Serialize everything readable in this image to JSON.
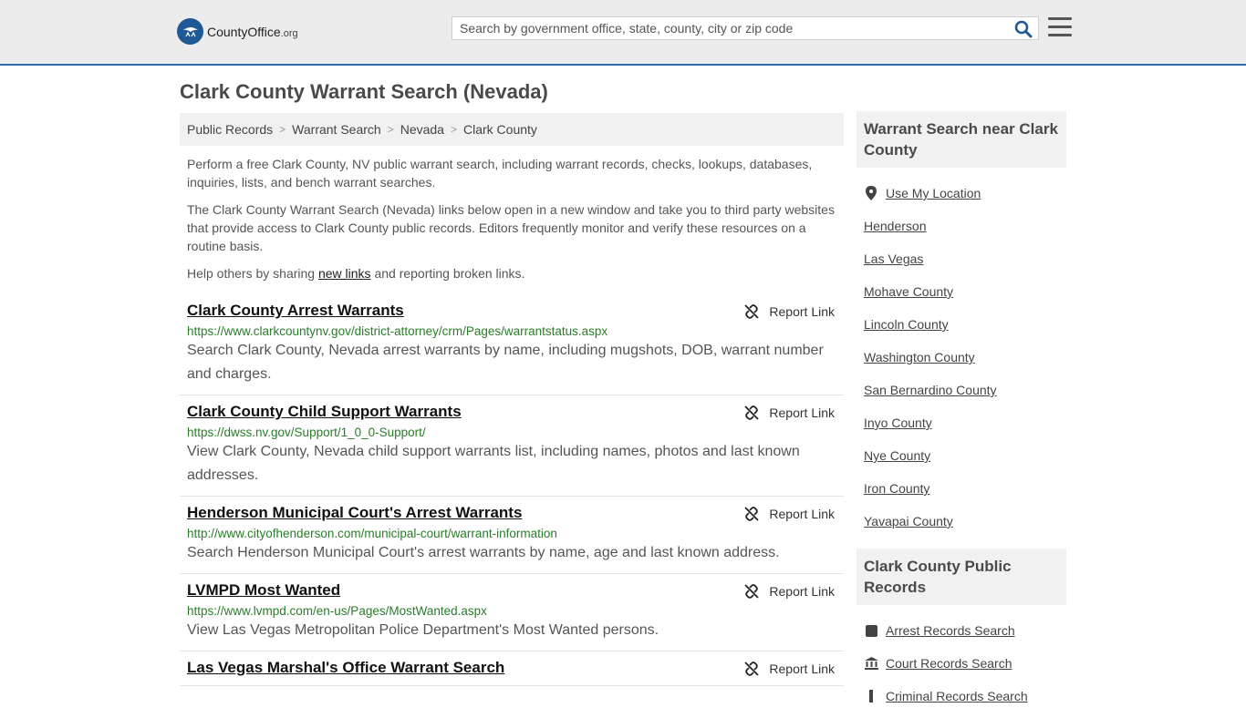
{
  "header": {
    "logo_name": "CountyOffice",
    "logo_domain": ".org",
    "search_placeholder": "Search by government office, state, county, city or zip code"
  },
  "page": {
    "title": "Clark County Warrant Search (Nevada)",
    "breadcrumbs": [
      "Public Records",
      "Warrant Search",
      "Nevada",
      "Clark County"
    ],
    "intro1": "Perform a free Clark County, NV public warrant search, including warrant records, checks, lookups, databases, inquiries, lists, and bench warrant searches.",
    "intro2": "The Clark County Warrant Search (Nevada) links below open in a new window and take you to third party websites that provide access to Clark County public records. Editors frequently monitor and verify these resources on a routine basis.",
    "intro3_pre": "Help others by sharing ",
    "intro3_link": "new links",
    "intro3_post": " and reporting broken links."
  },
  "report_label": "Report Link",
  "results": [
    {
      "title": "Clark County Arrest Warrants",
      "url": "https://www.clarkcountynv.gov/district-attorney/crm/Pages/warrantstatus.aspx",
      "desc": "Search Clark County, Nevada arrest warrants by name, including mugshots, DOB, warrant number and charges."
    },
    {
      "title": "Clark County Child Support Warrants",
      "url": "https://dwss.nv.gov/Support/1_0_0-Support/",
      "desc": "View Clark County, Nevada child support warrants list, including names, photos and last known addresses."
    },
    {
      "title": "Henderson Municipal Court's Arrest Warrants",
      "url": "http://www.cityofhenderson.com/municipal-court/warrant-information",
      "desc": "Search Henderson Municipal Court's arrest warrants by name, age and last known address."
    },
    {
      "title": "LVMPD Most Wanted",
      "url": "https://www.lvmpd.com/en-us/Pages/MostWanted.aspx",
      "desc": "View Las Vegas Metropolitan Police Department's Most Wanted persons."
    },
    {
      "title": "Las Vegas Marshal's Office Warrant Search",
      "url": "",
      "desc": ""
    }
  ],
  "sidebar": {
    "near_title": "Warrant Search near Clark County",
    "near_items": [
      "Use My Location",
      "Henderson",
      "Las Vegas",
      "Mohave County",
      "Lincoln County",
      "Washington County",
      "San Bernardino County",
      "Inyo County",
      "Nye County",
      "Iron County",
      "Yavapai County"
    ],
    "records_title": "Clark County Public Records",
    "records_items": [
      "Arrest Records Search",
      "Court Records Search",
      "Criminal Records Search"
    ]
  }
}
